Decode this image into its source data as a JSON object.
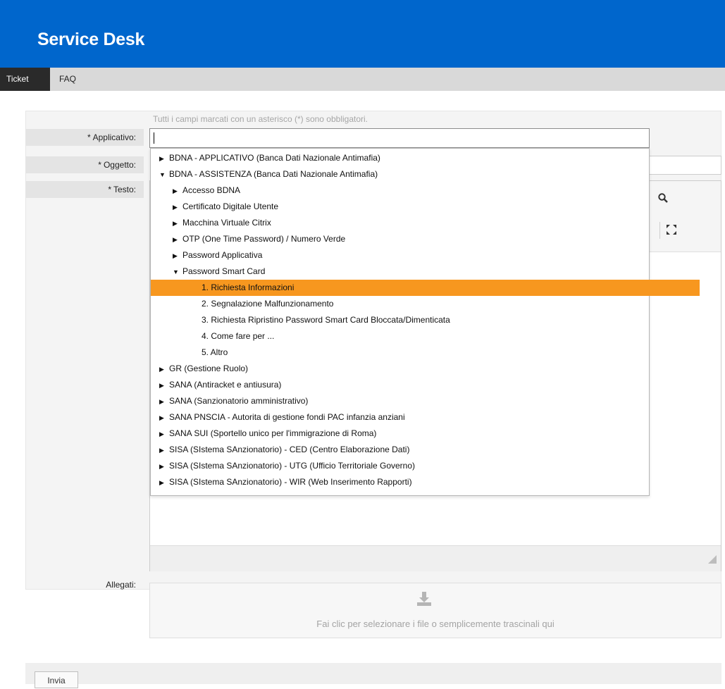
{
  "header": {
    "title": "Service Desk"
  },
  "nav": {
    "tabs": [
      "Ticket",
      "FAQ"
    ]
  },
  "form": {
    "hint": "Tutti i campi marcati con un asterisco (*) sono obbligatori.",
    "labels": {
      "applicativo": "Applicativo:",
      "oggetto": "Oggetto:",
      "testo": "Testo:",
      "allegati": "Allegati:"
    },
    "required_mark": "*",
    "attach_text": "Fai clic per selezionare i file o semplicemente trascinali qui",
    "submit_label": "Invia"
  },
  "dropdown": {
    "items": [
      {
        "text": "BDNA - APPLICATIVO (Banca Dati Nazionale Antimafia)",
        "level": 0,
        "arrow": "right"
      },
      {
        "text": "BDNA - ASSISTENZA (Banca Dati Nazionale Antimafia)",
        "level": 0,
        "arrow": "down"
      },
      {
        "text": "Accesso BDNA",
        "level": 1,
        "arrow": "right"
      },
      {
        "text": "Certificato Digitale Utente",
        "level": 1,
        "arrow": "right"
      },
      {
        "text": "Macchina Virtuale Citrix",
        "level": 1,
        "arrow": "right"
      },
      {
        "text": "OTP (One Time Password) / Numero Verde",
        "level": 1,
        "arrow": "right"
      },
      {
        "text": "Password Applicativa",
        "level": 1,
        "arrow": "right"
      },
      {
        "text": "Password Smart Card",
        "level": 1,
        "arrow": "down"
      },
      {
        "text": "1. Richiesta Informazioni",
        "level": 2,
        "arrow": "",
        "selected": true
      },
      {
        "text": "2. Segnalazione Malfunzionamento",
        "level": 2,
        "arrow": ""
      },
      {
        "text": "3. Richiesta Ripristino Password Smart Card Bloccata/Dimenticata",
        "level": 2,
        "arrow": ""
      },
      {
        "text": "4. Come fare per ...",
        "level": 2,
        "arrow": ""
      },
      {
        "text": "5. Altro",
        "level": 2,
        "arrow": ""
      },
      {
        "text": "GR (Gestione Ruolo)",
        "level": 0,
        "arrow": "right"
      },
      {
        "text": "SANA (Antiracket e antiusura)",
        "level": 0,
        "arrow": "right"
      },
      {
        "text": "SANA (Sanzionatorio amministrativo)",
        "level": 0,
        "arrow": "right"
      },
      {
        "text": "SANA PNSCIA - Autorita di gestione fondi PAC infanzia anziani",
        "level": 0,
        "arrow": "right"
      },
      {
        "text": "SANA SUI (Sportello unico per l'immigrazione di Roma)",
        "level": 0,
        "arrow": "right"
      },
      {
        "text": "SISA (SIstema SAnzionatorio) - CED (Centro Elaborazione Dati)",
        "level": 0,
        "arrow": "right"
      },
      {
        "text": "SISA (SIstema SAnzionatorio) - UTG (Ufficio Territoriale Governo)",
        "level": 0,
        "arrow": "right"
      },
      {
        "text": "SISA (SIstema SAnzionatorio) - WIR (Web Inserimento Rapporti)",
        "level": 0,
        "arrow": "right"
      }
    ],
    "selected_color": "#f7971f"
  },
  "icons": {
    "editor_search": "search-icon",
    "editor_fullscreen": "fullscreen-icon",
    "attach": "upload-icon",
    "resize": "resize-handle-icon"
  },
  "colors": {
    "header": "#0066cc",
    "nav_active": "#2a2a2a",
    "nav_bg": "#d9d9d9"
  }
}
